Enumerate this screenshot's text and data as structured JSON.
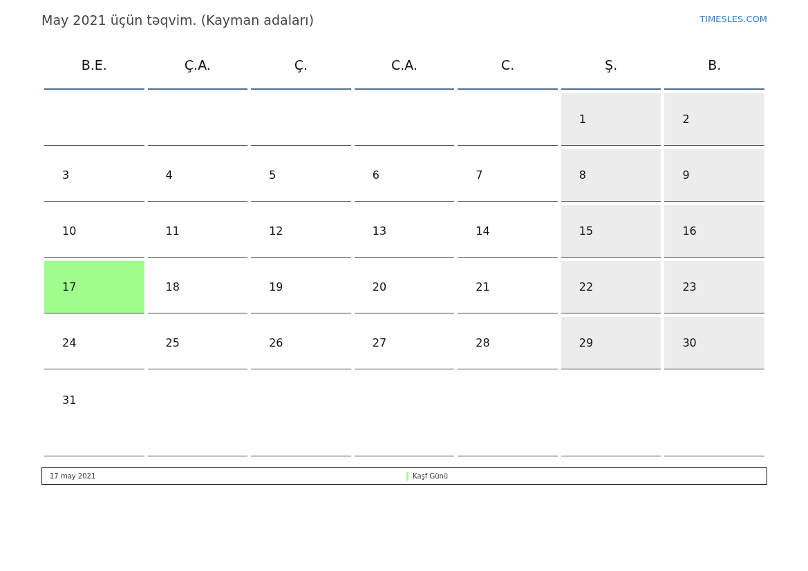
{
  "title": "May 2021 üçün təqvim. (Kayman adaları)",
  "site": "TIMESLES.COM",
  "weekdays": [
    "B.E.",
    "Ç.A.",
    "Ç.",
    "C.A.",
    "C.",
    "Ş.",
    "B."
  ],
  "weeks": [
    [
      {
        "kind": "blank"
      },
      {
        "kind": "blank"
      },
      {
        "kind": "blank"
      },
      {
        "kind": "blank"
      },
      {
        "kind": "blank"
      },
      {
        "kind": "day",
        "day": "1",
        "weekend": true,
        "holiday": false
      },
      {
        "kind": "day",
        "day": "2",
        "weekend": true,
        "holiday": false
      }
    ],
    [
      {
        "kind": "day",
        "day": "3",
        "weekend": false,
        "holiday": false
      },
      {
        "kind": "day",
        "day": "4",
        "weekend": false,
        "holiday": false
      },
      {
        "kind": "day",
        "day": "5",
        "weekend": false,
        "holiday": false
      },
      {
        "kind": "day",
        "day": "6",
        "weekend": false,
        "holiday": false
      },
      {
        "kind": "day",
        "day": "7",
        "weekend": false,
        "holiday": false
      },
      {
        "kind": "day",
        "day": "8",
        "weekend": true,
        "holiday": false
      },
      {
        "kind": "day",
        "day": "9",
        "weekend": true,
        "holiday": false
      }
    ],
    [
      {
        "kind": "day",
        "day": "10",
        "weekend": false,
        "holiday": false
      },
      {
        "kind": "day",
        "day": "11",
        "weekend": false,
        "holiday": false
      },
      {
        "kind": "day",
        "day": "12",
        "weekend": false,
        "holiday": false
      },
      {
        "kind": "day",
        "day": "13",
        "weekend": false,
        "holiday": false
      },
      {
        "kind": "day",
        "day": "14",
        "weekend": false,
        "holiday": false
      },
      {
        "kind": "day",
        "day": "15",
        "weekend": true,
        "holiday": false
      },
      {
        "kind": "day",
        "day": "16",
        "weekend": true,
        "holiday": false
      }
    ],
    [
      {
        "kind": "day",
        "day": "17",
        "weekend": false,
        "holiday": true
      },
      {
        "kind": "day",
        "day": "18",
        "weekend": false,
        "holiday": false
      },
      {
        "kind": "day",
        "day": "19",
        "weekend": false,
        "holiday": false
      },
      {
        "kind": "day",
        "day": "20",
        "weekend": false,
        "holiday": false
      },
      {
        "kind": "day",
        "day": "21",
        "weekend": false,
        "holiday": false
      },
      {
        "kind": "day",
        "day": "22",
        "weekend": true,
        "holiday": false
      },
      {
        "kind": "day",
        "day": "23",
        "weekend": true,
        "holiday": false
      }
    ],
    [
      {
        "kind": "day",
        "day": "24",
        "weekend": false,
        "holiday": false
      },
      {
        "kind": "day",
        "day": "25",
        "weekend": false,
        "holiday": false
      },
      {
        "kind": "day",
        "day": "26",
        "weekend": false,
        "holiday": false
      },
      {
        "kind": "day",
        "day": "27",
        "weekend": false,
        "holiday": false
      },
      {
        "kind": "day",
        "day": "28",
        "weekend": false,
        "holiday": false
      },
      {
        "kind": "day",
        "day": "29",
        "weekend": true,
        "holiday": false
      },
      {
        "kind": "day",
        "day": "30",
        "weekend": true,
        "holiday": false
      }
    ],
    [
      {
        "kind": "day",
        "day": "31",
        "weekend": false,
        "holiday": false
      },
      {
        "kind": "blank"
      },
      {
        "kind": "blank"
      },
      {
        "kind": "blank"
      },
      {
        "kind": "blank"
      },
      {
        "kind": "blank"
      },
      {
        "kind": "blank"
      }
    ]
  ],
  "legend": {
    "date": "17 may 2021",
    "name": "Kaşf Günü",
    "color": "#a0fc8c"
  }
}
